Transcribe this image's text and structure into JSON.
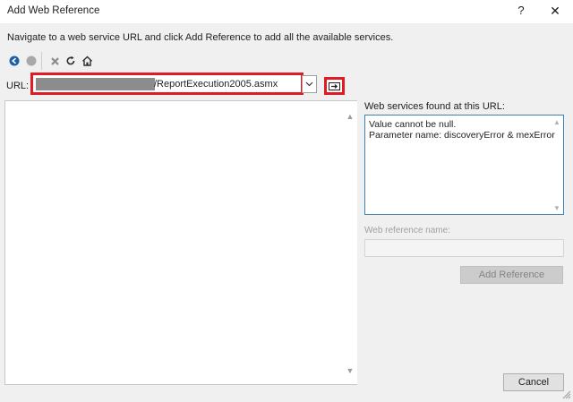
{
  "window": {
    "title": "Add Web Reference",
    "help_glyph": "?",
    "close_glyph": "✕"
  },
  "instructions": "Navigate to a web service URL and click Add Reference to add all the available services.",
  "toolbar": {
    "icons": [
      "back-icon",
      "forward-icon",
      "stop-icon",
      "refresh-icon",
      "home-icon"
    ]
  },
  "url": {
    "label": "URL:",
    "value_visible": "/ReportExecution2005.asmx"
  },
  "services": {
    "label": "Web services found at this URL:",
    "message": "Value cannot be null.\nParameter name: discoveryError & mexError"
  },
  "reference": {
    "name_label": "Web reference name:",
    "name_value": ""
  },
  "buttons": {
    "add_reference": "Add Reference",
    "cancel": "Cancel"
  },
  "colors": {
    "highlight": "#e01b24",
    "accent_border": "#3c7fb1",
    "nav_blue": "#1f5fa8"
  }
}
